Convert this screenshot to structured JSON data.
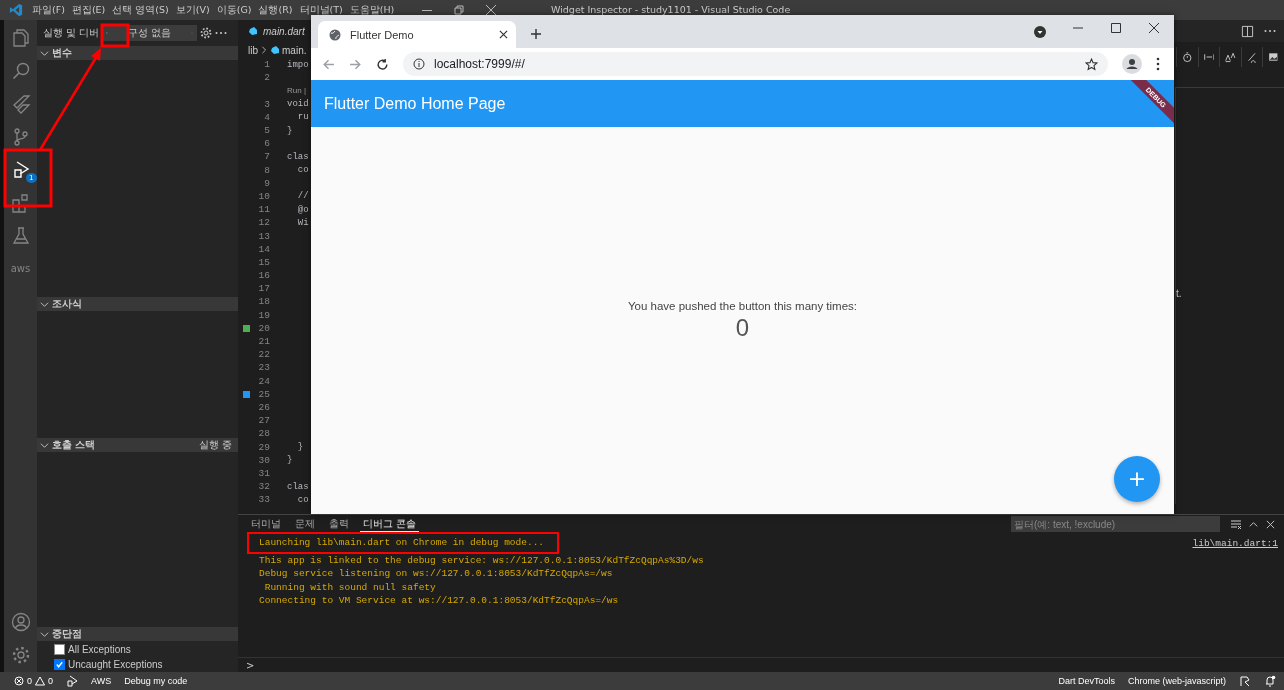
{
  "title_bar": {
    "menu": [
      "파일(F)",
      "편집(E)",
      "선택 영역(S)",
      "보기(V)",
      "이동(G)",
      "실행(R)",
      "터미널(T)",
      "도움말(H)"
    ],
    "title": "Widget Inspector - study1101 - Visual Studio Code"
  },
  "activity_bar": {
    "items": [
      {
        "kind": "files",
        "selected": false
      },
      {
        "kind": "search",
        "selected": false
      },
      {
        "kind": "flutter",
        "selected": false
      },
      {
        "kind": "branch",
        "selected": false
      },
      {
        "kind": "debug",
        "selected": true,
        "badge": "1"
      },
      {
        "kind": "extensions",
        "selected": false
      },
      {
        "kind": "flask",
        "selected": false
      },
      {
        "kind": "aws",
        "selected": false,
        "label": "aws"
      }
    ],
    "bottom_items": [
      {
        "kind": "account",
        "selected": false
      },
      {
        "kind": "gear",
        "selected": false
      }
    ]
  },
  "sidebar": {
    "title": "실행 및 디버",
    "config": "구성 없음",
    "sections": [
      {
        "title": "변수",
        "expanded": true
      },
      {
        "title": "조사식",
        "expanded": true
      },
      {
        "title": "호출 스택",
        "expanded": true,
        "status": "실행 중"
      },
      {
        "title": "중단점",
        "expanded": true,
        "breakpoints": [
          {
            "label": "All Exceptions",
            "checked": false
          },
          {
            "label": "Uncaught Exceptions",
            "checked": true
          }
        ]
      }
    ]
  },
  "editor": {
    "tab": "main.dart",
    "breadcrumb": [
      "lib",
      "main."
    ],
    "lines": [
      {
        "kind": "code",
        "number": "1",
        "text": "impo"
      },
      {
        "kind": "code",
        "number": "2"
      },
      {
        "kind": "codelens",
        "text": "Run |"
      },
      {
        "kind": "code",
        "number": "3",
        "text": "void"
      },
      {
        "kind": "code",
        "number": "4",
        "text": "  ru"
      },
      {
        "kind": "code",
        "number": "5",
        "text": "}"
      },
      {
        "kind": "code",
        "number": "6"
      },
      {
        "kind": "code",
        "number": "7",
        "text": "clas"
      },
      {
        "kind": "code",
        "number": "8",
        "text": "  co"
      },
      {
        "kind": "code",
        "number": "9"
      },
      {
        "kind": "code",
        "number": "10",
        "text": "  //"
      },
      {
        "kind": "code",
        "number": "11",
        "text": "  @o"
      },
      {
        "kind": "code",
        "number": "12",
        "text": "  Wi"
      },
      {
        "kind": "code",
        "number": "13"
      },
      {
        "kind": "code",
        "number": "14"
      },
      {
        "kind": "code",
        "number": "15"
      },
      {
        "kind": "code",
        "number": "16"
      },
      {
        "kind": "code",
        "number": "17"
      },
      {
        "kind": "code",
        "number": "18"
      },
      {
        "kind": "code",
        "number": "19"
      },
      {
        "kind": "code",
        "number": "20",
        "breakpoint": {
          "color": "#4caf50"
        }
      },
      {
        "kind": "code",
        "number": "21"
      },
      {
        "kind": "code",
        "number": "22"
      },
      {
        "kind": "code",
        "number": "23"
      },
      {
        "kind": "code",
        "number": "24"
      },
      {
        "kind": "code",
        "number": "25",
        "breakpoint": {
          "color": "#2196f3"
        }
      },
      {
        "kind": "code",
        "number": "26"
      },
      {
        "kind": "code",
        "number": "27"
      },
      {
        "kind": "code",
        "number": "28"
      },
      {
        "kind": "code",
        "number": "29",
        "text": "  }"
      },
      {
        "kind": "code",
        "number": "30",
        "text": "}"
      },
      {
        "kind": "code",
        "number": "31"
      },
      {
        "kind": "code",
        "number": "32",
        "text": "clas"
      },
      {
        "kind": "code",
        "number": "33",
        "text": "  co"
      }
    ],
    "side_text": "t."
  },
  "panel": {
    "tabs": [
      {
        "label": "터미널",
        "selected": false
      },
      {
        "label": "문제",
        "selected": false
      },
      {
        "label": "출력",
        "selected": false
      },
      {
        "label": "디버그 콘솔",
        "selected": true
      }
    ],
    "filter": {
      "placeholder": "필터(예: text, !exclude)"
    },
    "lines": [
      "Launching lib\\main.dart on Chrome in debug mode...",
      "This app is linked to the debug service: ws://127.0.0.1:8053/KdTfZcQqpAs%3D/ws",
      "Debug service listening on ws://127.0.0.1:8053/KdTfZcQqpAs=/ws",
      " Running with sound null safety",
      "Connecting to VM Service at ws://127.0.0.1:8053/KdTfZcQqpAs=/ws"
    ],
    "source_link": "lib\\main.dart:1",
    "prompt": ">"
  },
  "status_bar": {
    "errors": "0",
    "warnings": "0",
    "left": [
      "AWS",
      "Debug my code"
    ],
    "right": [
      "Dart DevTools",
      "Chrome (web-javascript)"
    ]
  },
  "browser": {
    "tab": "Flutter Demo",
    "url": "localhost:7999/#/",
    "app": {
      "title": "Flutter Demo Home Page",
      "banner": "DEBUG",
      "message": "You have pushed the button this many times:",
      "counter": "0",
      "fab": "+"
    }
  }
}
